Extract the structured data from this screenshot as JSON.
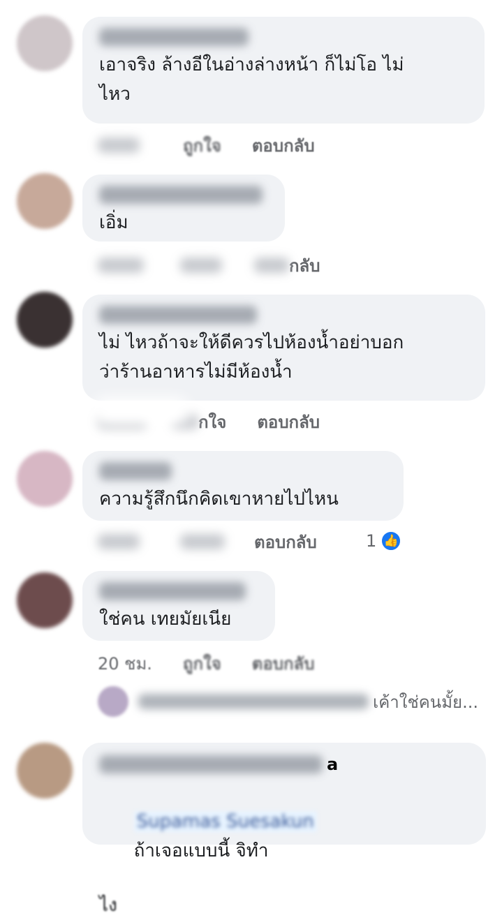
{
  "comments": [
    {
      "text": "เอาจริง ล้างอีในอ่างล่างหน้า ก็ไม่โอ ไม่\nไหว",
      "meta": {
        "time": "",
        "like": "ถูกใจ",
        "reply": "ตอบกลับ"
      },
      "avatar_color": "#cfc6c9"
    },
    {
      "text": "เอิ่ม",
      "meta": {
        "time": "",
        "like": "",
        "reply": "กลับ"
      },
      "avatar_color": "#c7a99a"
    },
    {
      "text": "ไม่ ไหวถ้าจะให้ดีควรไปห้องน้ำอย่าบอก\nว่าร้านอาหารไม่มีห้องน้ำ",
      "meta": {
        "time": "",
        "like": "กใจ",
        "reply": "ตอบกลับ"
      },
      "avatar_color": "#3a3132"
    },
    {
      "text": "ความรู้สึกนึกคิดเขาหายไปไหน",
      "meta": {
        "time": "",
        "like": "",
        "reply": "ตอบกลับ",
        "like_count": "1"
      },
      "avatar_color": "#d7b7c4"
    },
    {
      "text": "ใช่คน เทยมัยเนีย",
      "meta": {
        "time": "20 ชม.",
        "like": "ถูกใจ",
        "reply": "ตอบกลับ"
      },
      "avatar_color": "#6d4c4d"
    }
  ],
  "reply_preview": {
    "text": "เค้าใช่คนมั้ย..."
  },
  "last_comment": {
    "author_suffix": "a",
    "mention": "Supamas Suesakun",
    "text": "ถ้าเจอแบบนี้ จิทำ",
    "text_line2": "ไง",
    "avatar_color": "#b89a83"
  },
  "colors": {
    "bubble": "#f0f2f5",
    "meta_text": "#65676b",
    "like_blue": "#1877f2"
  },
  "icons": {
    "like": "thumbs-up-icon"
  }
}
